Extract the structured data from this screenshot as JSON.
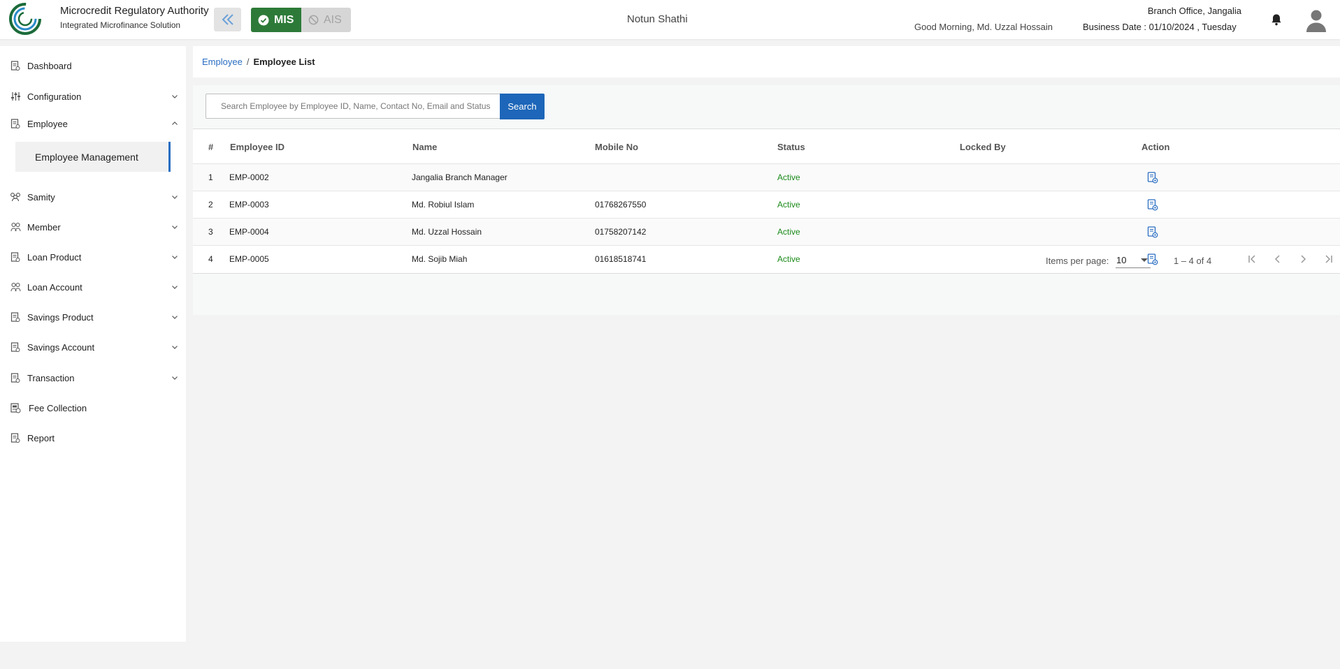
{
  "header": {
    "brand_title": "Microcredit Regulatory Authority",
    "brand_subtitle": "Integrated Microfinance Solution",
    "logo_text": "Microcredit Regulatory Authority",
    "mode_active": "MIS",
    "mode_inactive": "AIS",
    "org_name": "Notun Shathi",
    "greeting": "Good Morning, Md. Uzzal Hossain",
    "branch": "Branch Office, Jangalia",
    "business_date": "Business Date : 01/10/2024 , Tuesday",
    "icons": {
      "collapse": "double-chevron-left-icon",
      "bell": "bell-icon",
      "avatar": "user-avatar-icon"
    }
  },
  "sidebar": {
    "items": [
      {
        "label": "Dashboard",
        "icon": "document-icon",
        "expandable": false
      },
      {
        "label": "Configuration",
        "icon": "sliders-icon",
        "expandable": true
      },
      {
        "label": "Employee",
        "icon": "document-icon",
        "expandable": true,
        "expanded": true
      },
      {
        "label": "Samity",
        "icon": "group-icon",
        "expandable": true
      },
      {
        "label": "Member",
        "icon": "people-icon",
        "expandable": true
      },
      {
        "label": "Loan Product",
        "icon": "document-icon",
        "expandable": true
      },
      {
        "label": "Loan Account",
        "icon": "people-icon",
        "expandable": true
      },
      {
        "label": "Savings Product",
        "icon": "document-icon",
        "expandable": true
      },
      {
        "label": "Savings Account",
        "icon": "document-icon",
        "expandable": true
      },
      {
        "label": "Transaction",
        "icon": "document-icon",
        "expandable": true
      },
      {
        "label": "Fee Collection",
        "icon": "receipt-icon",
        "expandable": false
      },
      {
        "label": "Report",
        "icon": "document-icon",
        "expandable": false
      }
    ],
    "sub_item": "Employee Management"
  },
  "breadcrumb": {
    "parent": "Employee",
    "separator": "/",
    "current": "Employee List"
  },
  "search": {
    "placeholder": "Search Employee by Employee ID, Name, Contact No, Email and Status",
    "value": "",
    "button": "Search"
  },
  "table": {
    "columns": [
      "#",
      "Employee ID",
      "Name",
      "Mobile No",
      "Status",
      "Locked By",
      "Action"
    ],
    "rows": [
      {
        "no": "1",
        "id": "EMP-0002",
        "name": "Jangalia Branch Manager",
        "mobile": "",
        "status": "Active",
        "locked_by": ""
      },
      {
        "no": "2",
        "id": "EMP-0003",
        "name": "Md. Robiul Islam",
        "mobile": "01768267550",
        "status": "Active",
        "locked_by": ""
      },
      {
        "no": "3",
        "id": "EMP-0004",
        "name": "Md. Uzzal Hossain",
        "mobile": "01758207142",
        "status": "Active",
        "locked_by": ""
      },
      {
        "no": "4",
        "id": "EMP-0005",
        "name": "Md. Sojib Miah",
        "mobile": "01618518741",
        "status": "Active",
        "locked_by": ""
      }
    ],
    "action_icon": "view-document-icon"
  },
  "paginator": {
    "items_per_page_label": "Items per page:",
    "items_per_page": "10",
    "range": "1 – 4 of 4"
  },
  "colors": {
    "accent": "#1d66b9",
    "mis_active": "#2d7a38",
    "status_active": "#1a8a1a",
    "link": "#2a6ec2"
  }
}
